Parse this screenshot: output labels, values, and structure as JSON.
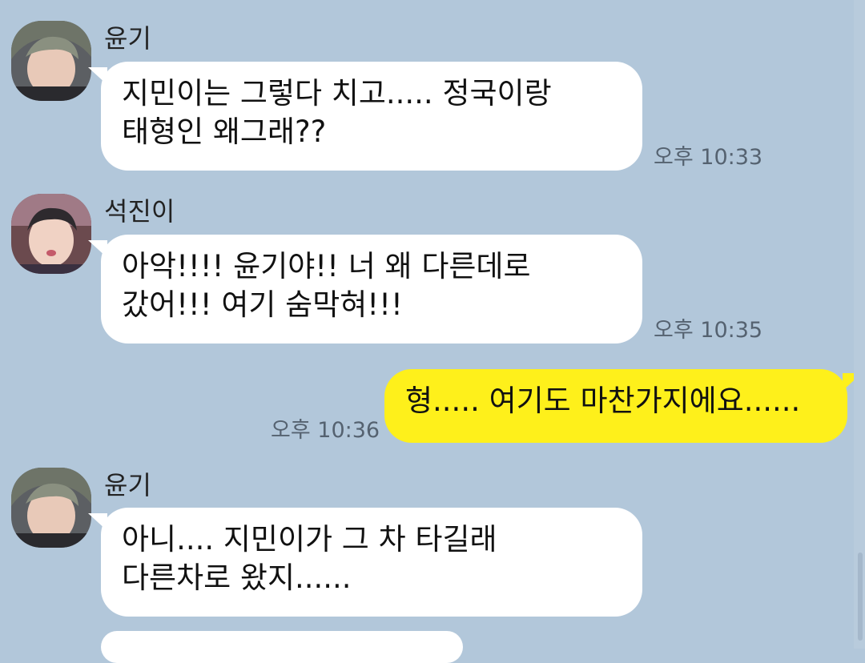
{
  "messages": [
    {
      "sender": "윤기",
      "lines": [
        "지민이는 그렇다 치고..... 정국이랑",
        "태형인 왜그래??"
      ],
      "time": "오후 10:33"
    },
    {
      "sender": "석진이",
      "lines": [
        "아악!!!! 윤기야!! 너 왜 다른데로",
        "갔어!!! 여기 숨막혀!!!"
      ],
      "time": "오후 10:35"
    },
    {
      "sender": "me",
      "lines": [
        "형..... 여기도 마찬가지에요......"
      ],
      "time": "오후 10:36"
    },
    {
      "sender": "윤기",
      "lines": [
        "아니.... 지민이가 그 차 타길래",
        "다른차로 왔지......"
      ],
      "time": ""
    }
  ],
  "colors": {
    "background": "#b2c7da",
    "incoming_bubble": "#ffffff",
    "outgoing_bubble": "#fef01b",
    "timestamp": "#556270"
  },
  "avatars": [
    "avatar-yoongi",
    "avatar-seokjin",
    "avatar-yoongi"
  ]
}
